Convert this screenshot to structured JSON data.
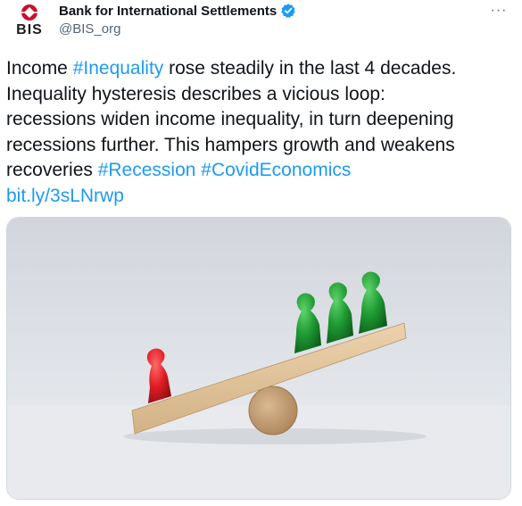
{
  "account": {
    "display_name": "Bank for International Settlements",
    "handle": "@BIS_org",
    "avatar_text": "BIS",
    "verified": true,
    "avatar_icon": "bis-logo-icon"
  },
  "menu": {
    "more_label": "···"
  },
  "tweet": {
    "lines": [
      {
        "parts": [
          {
            "type": "text",
            "value": "Income "
          },
          {
            "type": "hashtag",
            "value": "#Inequality"
          },
          {
            "type": "text",
            "value": " rose steadily in the last 4 decades."
          }
        ]
      },
      {
        "parts": [
          {
            "type": "text",
            "value": "Inequality hysteresis describes a vicious loop:"
          }
        ]
      },
      {
        "parts": [
          {
            "type": "text",
            "value": "recessions widen income inequality, in turn deepening"
          }
        ]
      },
      {
        "parts": [
          {
            "type": "text",
            "value": "recessions further. This hampers growth and weakens"
          }
        ]
      },
      {
        "parts": [
          {
            "type": "text",
            "value": "recoveries "
          },
          {
            "type": "hashtag",
            "value": "#Recession"
          },
          {
            "type": "text",
            "value": " "
          },
          {
            "type": "hashtag",
            "value": "#CovidEconomics"
          }
        ]
      },
      {
        "parts": [
          {
            "type": "link",
            "value": "bit.ly/3sLNrwp"
          }
        ]
      }
    ]
  },
  "media": {
    "icon": "seesaw-pawns-image"
  },
  "colors": {
    "link": "#1d9bf0",
    "verified": "#1d9bf0",
    "text": "#0f1419",
    "secondary": "#536471",
    "logo_red": "#c8102e"
  }
}
